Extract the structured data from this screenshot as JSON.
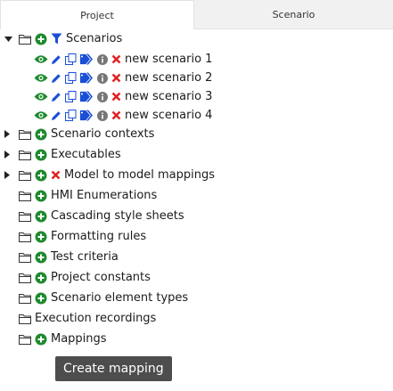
{
  "tabs": [
    {
      "label": "Project",
      "active": true
    },
    {
      "label": "Scenario",
      "active": false
    }
  ],
  "tree": {
    "scenarios": {
      "label": "Scenarios",
      "children": [
        "new scenario 1",
        "new scenario 2",
        "new scenario 3",
        "new scenario 4"
      ]
    },
    "nodes": {
      "scenario_contexts": "Scenario contexts",
      "executables": "Executables",
      "model_mappings": "Model to model mappings",
      "hmi_enumerations": "HMI Enumerations",
      "cascading_style_sheets": "Cascading style sheets",
      "formatting_rules": "Formatting rules",
      "test_criteria": "Test criteria",
      "project_constants": "Project constants",
      "scenario_element_types": "Scenario element types",
      "execution_recordings": "Execution recordings",
      "mappings": "Mappings"
    }
  },
  "tooltip": "Create mapping",
  "colors": {
    "green": "#1e8a2e",
    "red": "#e02020",
    "blue": "#1a4fd6",
    "gray": "#777777",
    "tooltip_bg": "#4d4d4d"
  }
}
